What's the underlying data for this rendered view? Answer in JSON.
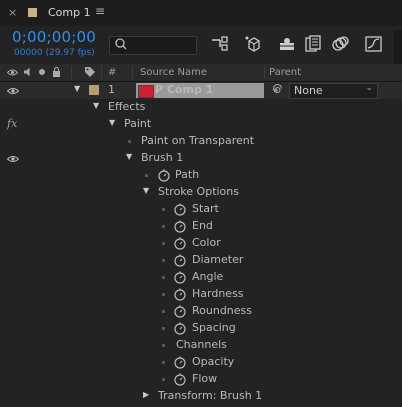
{
  "tab": {
    "title": "Comp 1",
    "close_glyph": "×",
    "menu_glyph": "≡"
  },
  "toolbar": {
    "timecode": "0;00;00;00",
    "fps": "00000 (29.97 fps)"
  },
  "columns": {
    "num": "#",
    "source_name": "Source Name",
    "parent": "Parent"
  },
  "layer": {
    "number": "1",
    "name": "P Comp 1",
    "parent_value": "None",
    "label_color": "#b59d73"
  },
  "tree": {
    "effects": "Effects",
    "fx": "fx",
    "paint": "Paint",
    "paint_on_transparent": "Paint on Transparent",
    "brush": "Brush 1",
    "path": "Path",
    "stroke_options": "Stroke Options",
    "stroke_props": [
      "Start",
      "End",
      "Color",
      "Diameter",
      "Angle",
      "Hardness",
      "Roundness",
      "Spacing"
    ],
    "channels": "Channels",
    "channel_props": [
      "Opacity",
      "Flow"
    ],
    "transform": "Transform: Brush 1"
  },
  "colors": {
    "accent": "#2e8ef0",
    "background": "#232323"
  }
}
